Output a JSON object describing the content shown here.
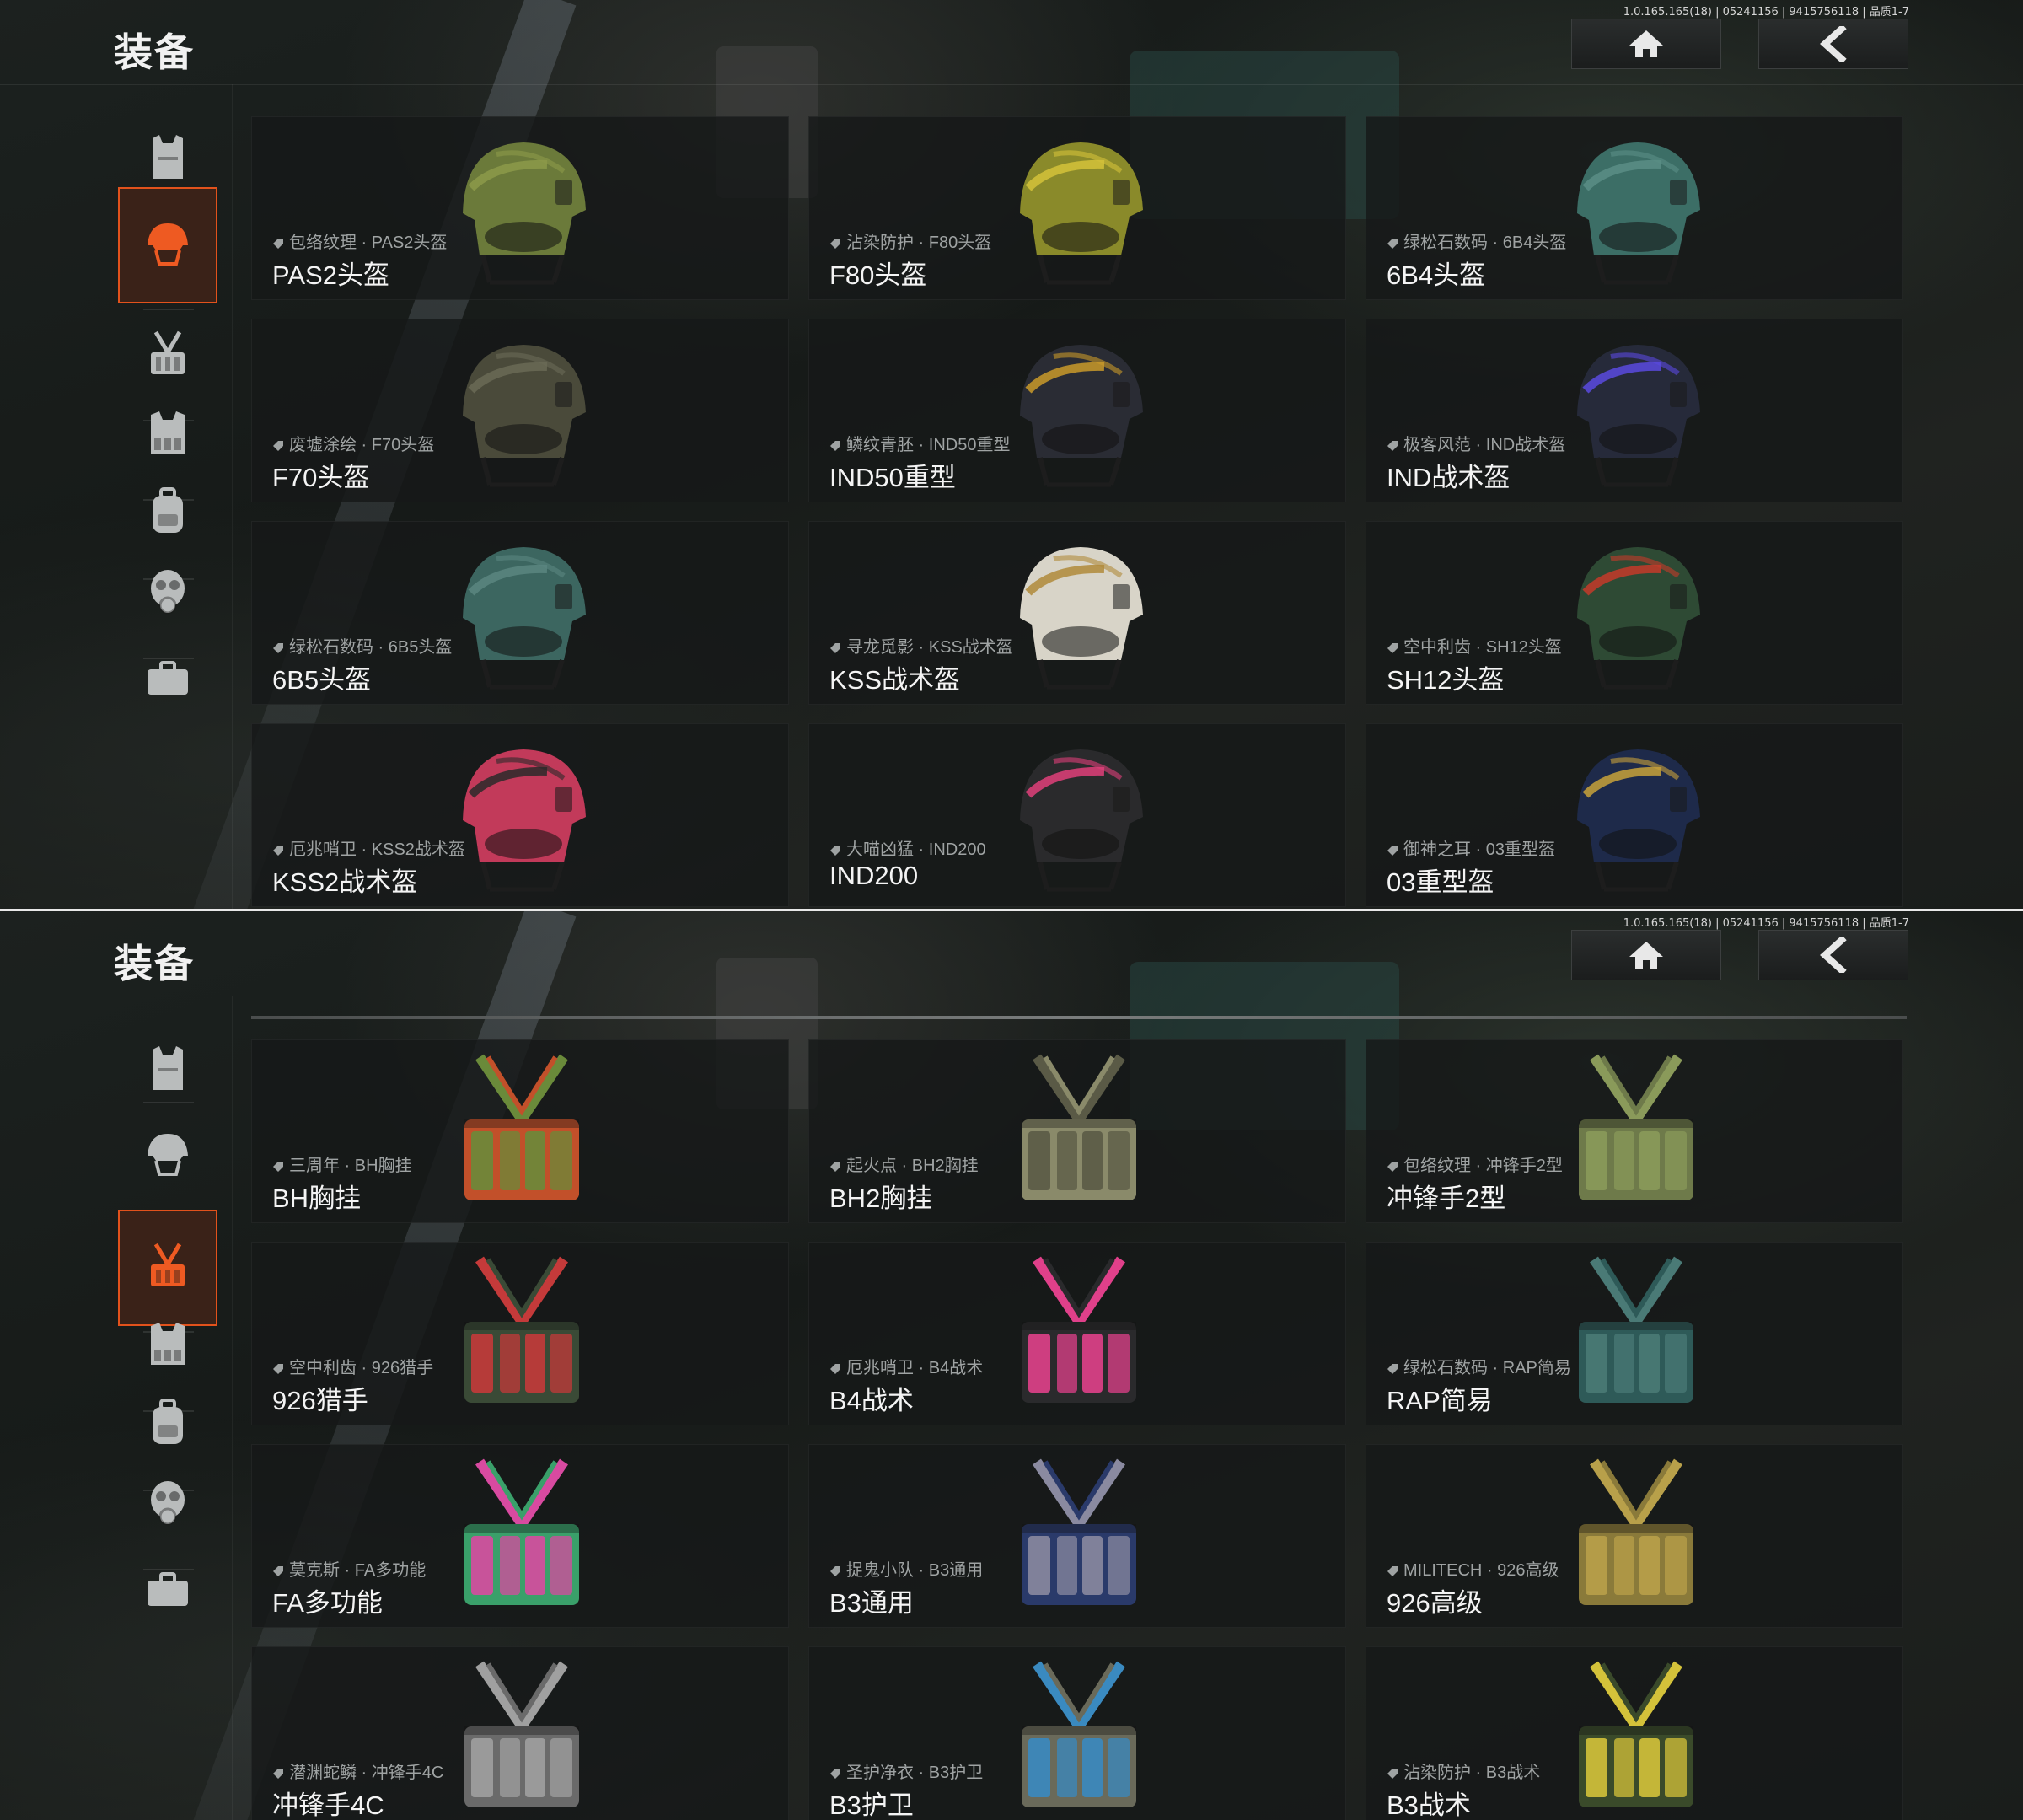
{
  "build_info": "1.0.165.165(18) | 05241156 | 9415756118 | 品质1-7",
  "screens": [
    {
      "title": "装备",
      "active_category": 1,
      "categories": [
        {
          "icon": "vest-icon"
        },
        {
          "icon": "helmet-icon"
        },
        {
          "icon": "chest-rig-icon"
        },
        {
          "icon": "armor-rig-icon"
        },
        {
          "icon": "backpack-icon"
        },
        {
          "icon": "gas-mask-icon"
        },
        {
          "icon": "case-icon"
        }
      ],
      "items": [
        {
          "skin": "包络纹理 · PAS2头盔",
          "name": "PAS2头盔",
          "colors": [
            "#6b7a3a",
            "#8c9a4a"
          ]
        },
        {
          "skin": "沾染防护 · F80头盔",
          "name": "F80头盔",
          "colors": [
            "#8a8a2a",
            "#d4c23a"
          ]
        },
        {
          "skin": "绿松石数码 · 6B4头盔",
          "name": "6B4头盔",
          "colors": [
            "#3c6e66",
            "#5a8e86"
          ]
        },
        {
          "skin": "废墟涂绘 · F70头盔",
          "name": "F70头盔",
          "colors": [
            "#4a4a3a",
            "#6a6a56"
          ]
        },
        {
          "skin": "鳞纹青胚 · IND50重型",
          "name": "IND50重型",
          "colors": [
            "#2a2c34",
            "#c99a2a"
          ]
        },
        {
          "skin": "极客风范 · IND战术盔",
          "name": "IND战术盔",
          "colors": [
            "#262a3a",
            "#5a4ae0"
          ]
        },
        {
          "skin": "绿松石数码 · 6B5头盔",
          "name": "6B5头盔",
          "colors": [
            "#3c6660",
            "#5a8680"
          ]
        },
        {
          "skin": "寻龙觅影 · KSS战术盔",
          "name": "KSS战术盔",
          "colors": [
            "#d8d4c8",
            "#b08a3a"
          ]
        },
        {
          "skin": "空中利齿 · SH12头盔",
          "name": "SH12头盔",
          "colors": [
            "#2e4a34",
            "#c43a2a"
          ]
        },
        {
          "skin": "厄兆哨卫 · KSS2战术盔",
          "name": "KSS2战术盔",
          "colors": [
            "#c23a5a",
            "#2a2a2a"
          ]
        },
        {
          "skin": "大喵凶猛 · IND200",
          "name": "IND200",
          "colors": [
            "#2a2a2c",
            "#e0407a"
          ]
        },
        {
          "skin": "御神之耳 · 03重型盔",
          "name": "03重型盔",
          "colors": [
            "#1e2a4a",
            "#c8a23a"
          ]
        }
      ]
    },
    {
      "title": "装备",
      "active_category": 2,
      "categories": [
        {
          "icon": "vest-icon"
        },
        {
          "icon": "helmet-icon"
        },
        {
          "icon": "chest-rig-icon"
        },
        {
          "icon": "armor-rig-icon"
        },
        {
          "icon": "backpack-icon"
        },
        {
          "icon": "gas-mask-icon"
        },
        {
          "icon": "case-icon"
        }
      ],
      "items": [
        {
          "skin": "三周年 · BH胸挂",
          "name": "BH胸挂",
          "colors": [
            "#c2502a",
            "#6a8a3a"
          ]
        },
        {
          "skin": "起火点 · BH2胸挂",
          "name": "BH2胸挂",
          "colors": [
            "#8a8a6a",
            "#5a5a46"
          ]
        },
        {
          "skin": "包络纹理 · 冲锋手2型",
          "name": "冲锋手2型",
          "colors": [
            "#6e7a4a",
            "#8a9a5a"
          ]
        },
        {
          "skin": "空中利齿 · 926猎手",
          "name": "926猎手",
          "colors": [
            "#3a4a36",
            "#c43a3a"
          ]
        },
        {
          "skin": "厄兆哨卫 · B4战术",
          "name": "B4战术",
          "colors": [
            "#2a2a2c",
            "#e0408a"
          ]
        },
        {
          "skin": "绿松石数码 · RAP简易",
          "name": "RAP简易",
          "colors": [
            "#2e5a58",
            "#4a7a76"
          ]
        },
        {
          "skin": "莫克斯 · FA多功能",
          "name": "FA多功能",
          "colors": [
            "#3aa06a",
            "#d84aa0"
          ]
        },
        {
          "skin": "捉鬼小队 · B3通用",
          "name": "B3通用",
          "colors": [
            "#2a3a6a",
            "#8a8aa0"
          ]
        },
        {
          "skin": "MILITECH · 926高级",
          "name": "926高级",
          "colors": [
            "#8a7a3a",
            "#b8a04a"
          ]
        },
        {
          "skin": "潜渊蛇鳞 · 冲锋手4C",
          "name": "冲锋手4C",
          "colors": [
            "#6a6a6a",
            "#a0a0a0"
          ]
        },
        {
          "skin": "圣护净衣 · B3护卫",
          "name": "B3护卫",
          "colors": [
            "#6a6a5a",
            "#3a8ac0"
          ]
        },
        {
          "skin": "沾染防护 · B3战术",
          "name": "B3战术",
          "colors": [
            "#3a4a2a",
            "#d4c23a"
          ]
        }
      ]
    }
  ]
}
